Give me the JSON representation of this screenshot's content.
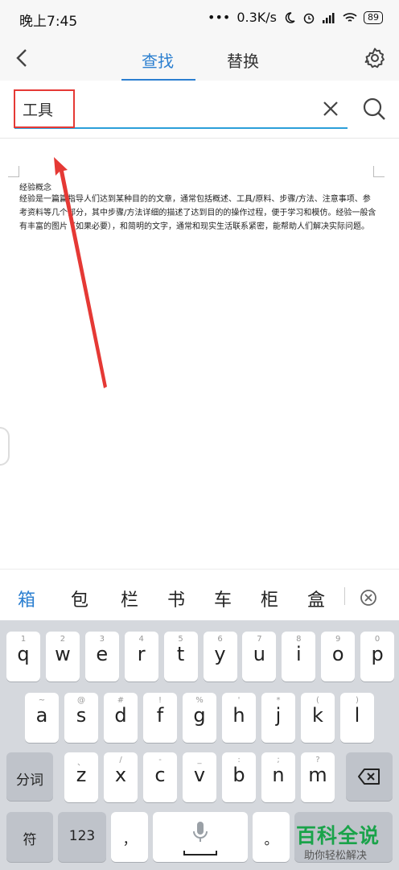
{
  "status": {
    "time": "晚上7:45",
    "dots": "•••",
    "speed": "0.3K/s",
    "battery": "89"
  },
  "nav": {
    "tab_find": "查找",
    "tab_replace": "替换"
  },
  "search": {
    "value": "工具"
  },
  "doc": {
    "heading": "经验概念",
    "body": "经验是一篇篇指导人们达到某种目的的文章，通常包括概述、工具/原料、步骤/方法、注意事项、参考资料等几个部分，其中步骤/方法详细的描述了达到目的的操作过程，便于学习和模仿。经验一般含有丰富的图片（如果必要），和简明的文字，通常和现实生活联系紧密，能帮助人们解决实际问题。"
  },
  "candidates": [
    "箱",
    "包",
    "栏",
    "书",
    "车",
    "柜",
    "盒"
  ],
  "keyboard": {
    "row1": [
      {
        "sub": "1",
        "main": "q"
      },
      {
        "sub": "2",
        "main": "w"
      },
      {
        "sub": "3",
        "main": "e"
      },
      {
        "sub": "4",
        "main": "r"
      },
      {
        "sub": "5",
        "main": "t"
      },
      {
        "sub": "6",
        "main": "y"
      },
      {
        "sub": "7",
        "main": "u"
      },
      {
        "sub": "8",
        "main": "i"
      },
      {
        "sub": "9",
        "main": "o"
      },
      {
        "sub": "0",
        "main": "p"
      }
    ],
    "row2": [
      {
        "sub": "~",
        "main": "a"
      },
      {
        "sub": "@",
        "main": "s"
      },
      {
        "sub": "#",
        "main": "d"
      },
      {
        "sub": "!",
        "main": "f"
      },
      {
        "sub": "%",
        "main": "g"
      },
      {
        "sub": "'",
        "main": "h"
      },
      {
        "sub": "*",
        "main": "j"
      },
      {
        "sub": "(",
        "main": "k"
      },
      {
        "sub": ")",
        "main": "l"
      }
    ],
    "row3": [
      {
        "sub": "、",
        "main": "z"
      },
      {
        "sub": "/",
        "main": "x"
      },
      {
        "sub": "-",
        "main": "c"
      },
      {
        "sub": "_",
        "main": "v"
      },
      {
        "sub": ":",
        "main": "b"
      },
      {
        "sub": ";",
        "main": "n"
      },
      {
        "sub": "?",
        "main": "m"
      }
    ],
    "fenci": "分词",
    "fu": "符",
    "num": "123",
    "comma": "，",
    "period": "。"
  },
  "watermark": {
    "title": "百科全说",
    "subtitle": "助你轻松解决"
  },
  "colors": {
    "accent": "#2b7fd0",
    "highlight": "#e53935",
    "watermark": "#1aa34a"
  }
}
